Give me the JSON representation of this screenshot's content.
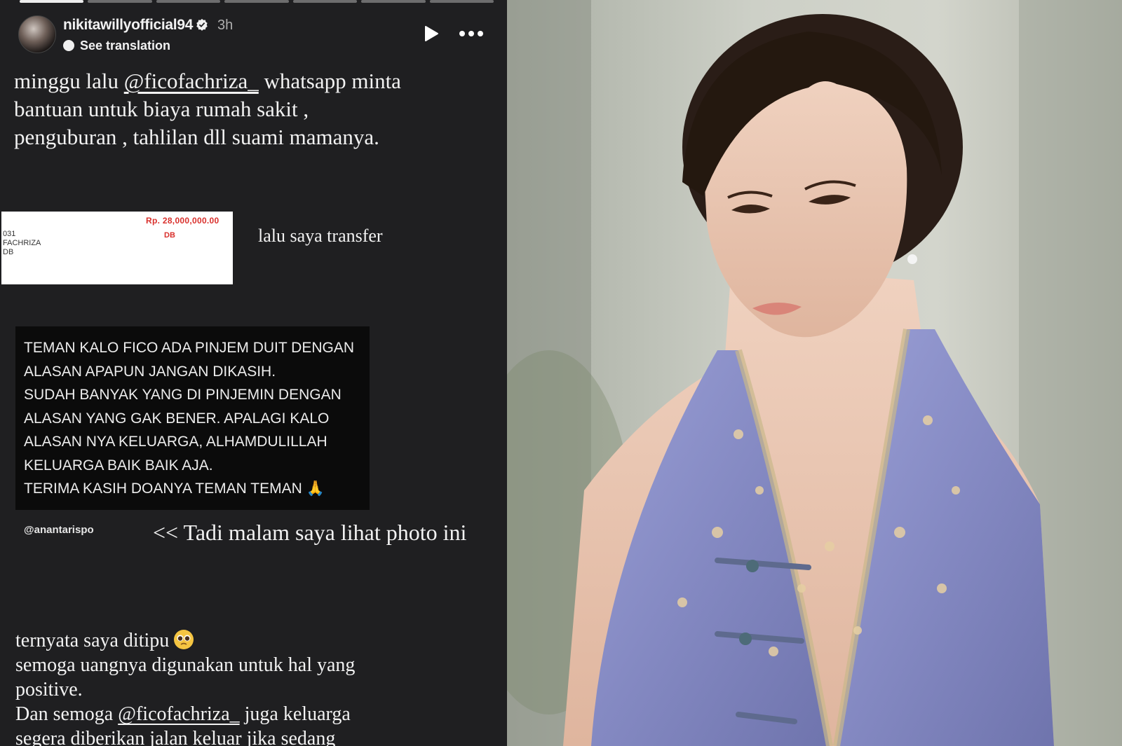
{
  "story": {
    "progress_segments": 7,
    "active_segment": 1,
    "username": "nikitawillyofficial94",
    "time_ago": "3h",
    "see_translation": "See translation",
    "caption_top": {
      "line1_pre": "minggu lalu ",
      "mention1": "@ficofachriza_",
      "line1_post": " whatsapp minta",
      "line2": "bantuan untuk biaya rumah sakit ,",
      "line3": "penguburan , tahlilan dll suami mamanya."
    },
    "receipt": {
      "amount": "Rp.  28,000,000.00",
      "code": "DB",
      "line1": "031",
      "line2": "FACHRIZA",
      "line3": "DB"
    },
    "transfer_text": "lalu saya transfer",
    "warning_lines": [
      "TEMAN KALO FICO ADA PINJEM DUIT DENGAN",
      "ALASAN APAPUN JANGAN DIKASIH.",
      "SUDAH BANYAK YANG DI PINJEMIN DENGAN",
      "ALASAN YANG GAK BENER. APALAGI KALO",
      "ALASAN NYA KELUARGA, ALHAMDULILLAH",
      "KELUARGA BAIK BAIK AJA.",
      "TERIMA KASIH DOANYA TEMAN TEMAN 🙏"
    ],
    "source_handle": "@anantarispo",
    "night_text": "<< Tadi malam saya lihat photo ini",
    "caption_bottom": {
      "line1": "ternyata saya ditipu",
      "line2": "semoga uangnya digunakan untuk hal yang",
      "line3": "positive.",
      "line4_pre": "Dan semoga ",
      "mention2": "@ficofachriza_",
      "line4_post": " juga keluarga",
      "line5": "segera diberikan jalan keluar jika sedang"
    },
    "icons": [
      "verified-badge-icon",
      "play-icon",
      "more-options-icon",
      "translate-icon",
      "pleading-face-emoji"
    ]
  },
  "colors": {
    "story_bg": "#1f1f21",
    "verified_blue": "#3897f0",
    "receipt_red": "#d9302c",
    "dress_lavender": "#8b90c8"
  }
}
